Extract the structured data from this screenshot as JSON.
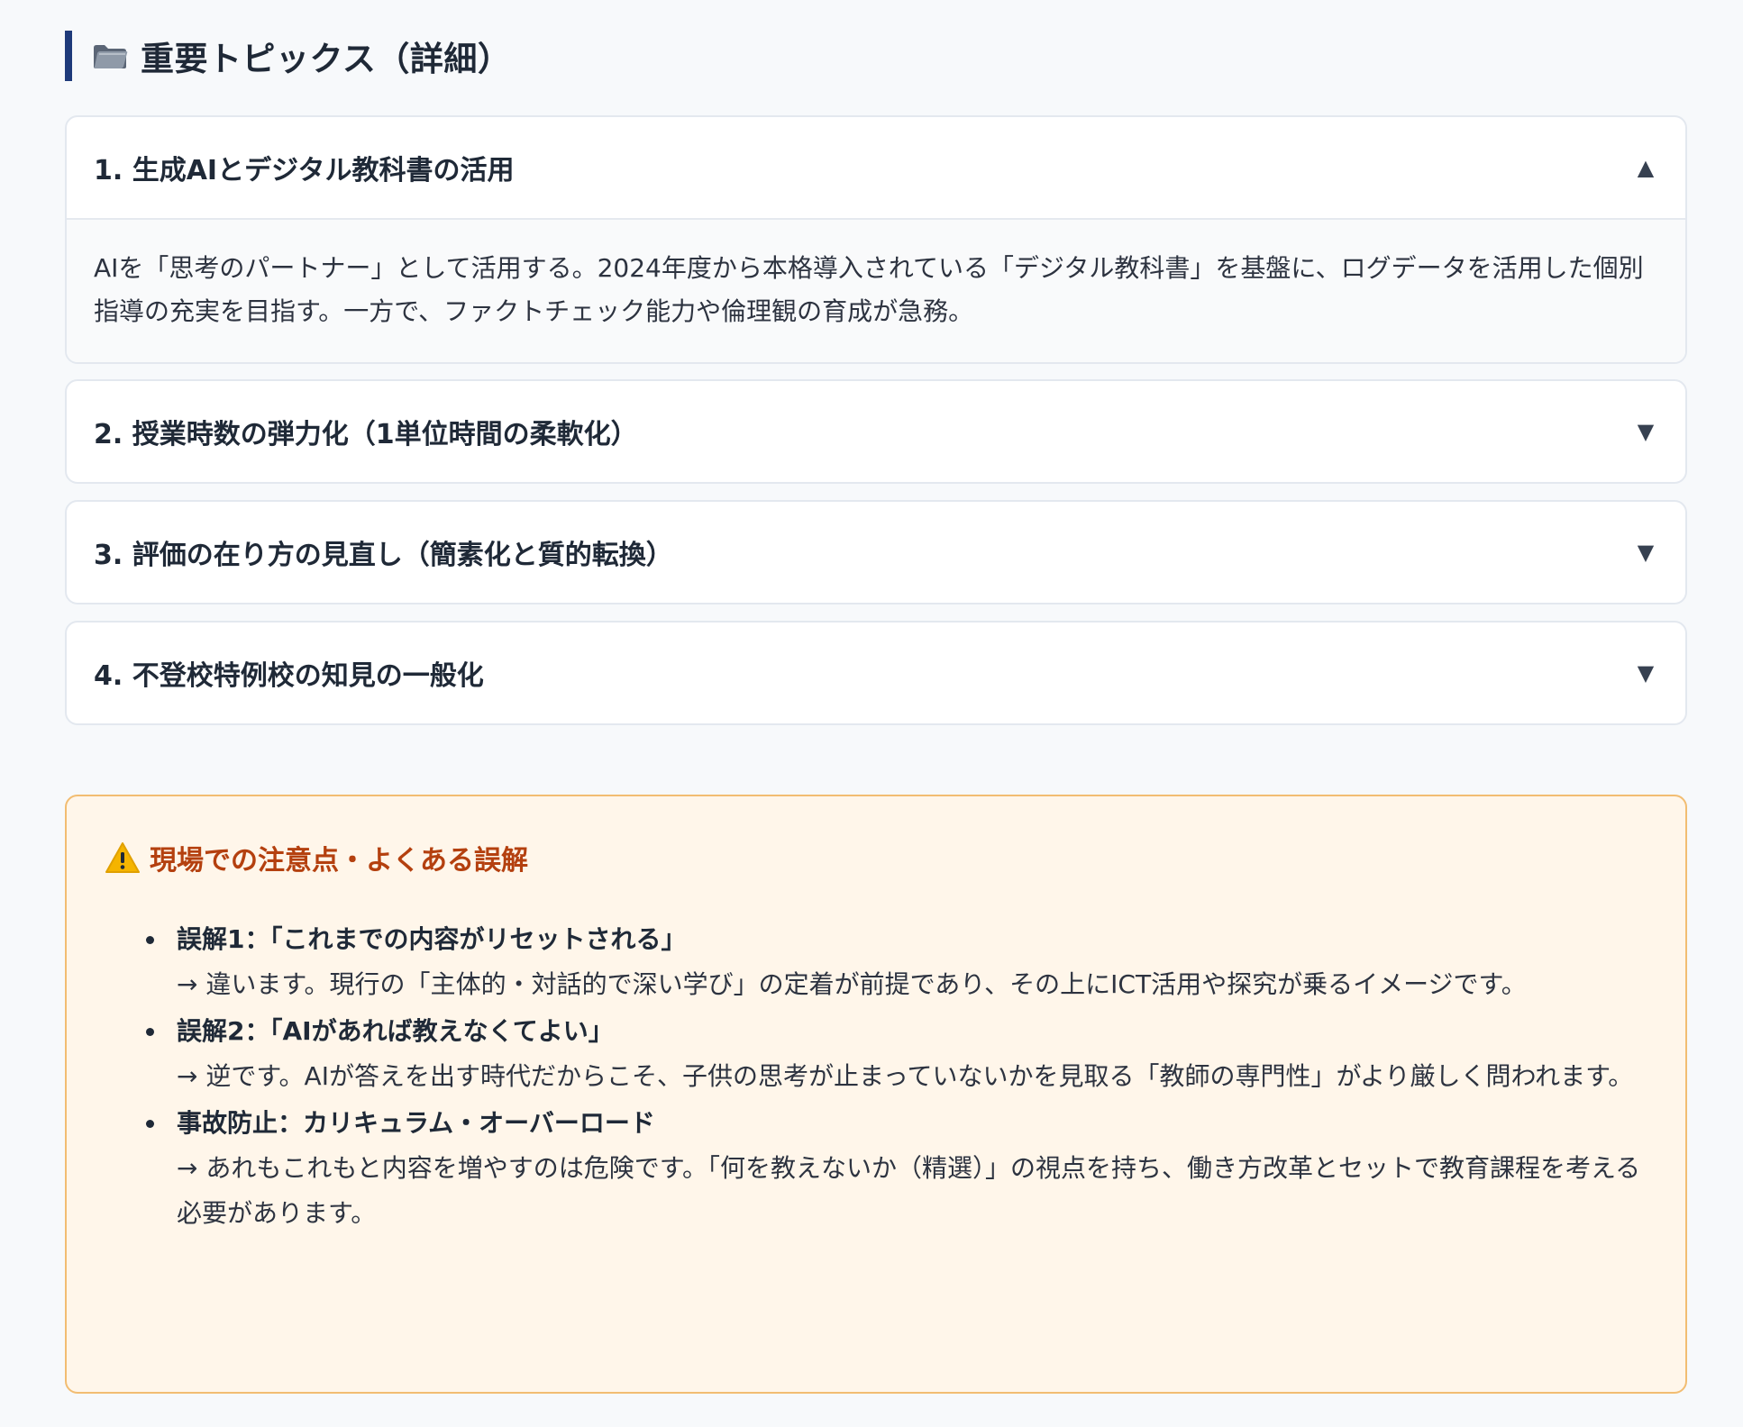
{
  "section": {
    "icon": "folder-icon",
    "title": "重要トピックス（詳細）"
  },
  "accordion": [
    {
      "title": "1. 生成AIとデジタル教科書の活用",
      "expanded": true,
      "caret": "▲",
      "body": "AIを「思考のパートナー」として活用する。2024年度から本格導入されている「デジタル教科書」を基盤に、ログデータを活用した個別指導の充実を目指す。一方で、ファクトチェック能力や倫理観の育成が急務。"
    },
    {
      "title": "2. 授業時数の弾力化（1単位時間の柔軟化）",
      "expanded": false,
      "caret": "▼"
    },
    {
      "title": "3. 評価の在り方の見直し（簡素化と質的転換）",
      "expanded": false,
      "caret": "▼"
    },
    {
      "title": "4. 不登校特例校の知見の一般化",
      "expanded": false,
      "caret": "▼"
    }
  ],
  "warning": {
    "icon": "warning-icon",
    "title": "現場での注意点・よくある誤解",
    "items": [
      {
        "title": "誤解1：「これまでの内容がリセットされる」",
        "text": "→ 違います。現行の「主体的・対話的で深い学び」の定着が前提であり、その上にICT活用や探究が乗るイメージです。"
      },
      {
        "title": "誤解2：「AIがあれば教えなくてよい」",
        "text": "→ 逆です。AIが答えを出す時代だからこそ、子供の思考が止まっていないかを見取る「教師の専門性」がより厳しく問われます。"
      },
      {
        "title": "事故防止：カリキュラム・オーバーロード",
        "text": "→ あれもこれもと内容を増やすのは危険です。「何を教えないか（精選）」の視点を持ち、働き方改革とセットで教育課程を考える必要があります。"
      }
    ]
  },
  "colors": {
    "accent": "#1e3a7a",
    "warning_border": "#f2bd72",
    "warning_bg": "#fff6ea",
    "warning_title": "#b4400f"
  }
}
